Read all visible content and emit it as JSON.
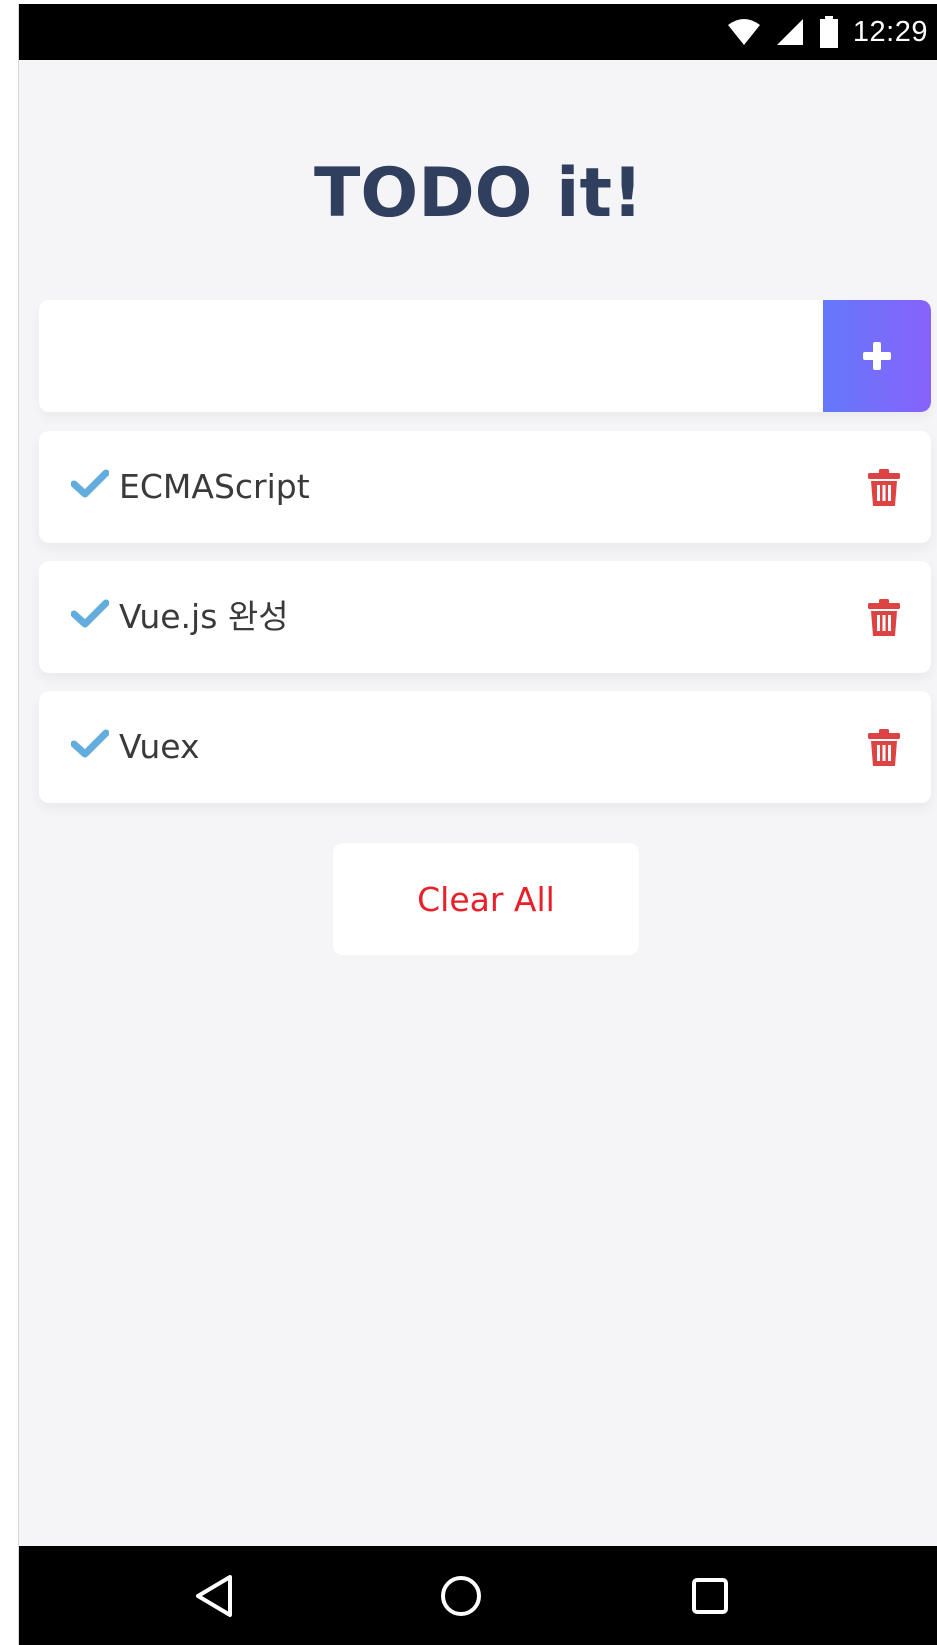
{
  "status_bar": {
    "time": "12:29",
    "icons": [
      "wifi-icon",
      "cell-signal-icon",
      "battery-icon"
    ]
  },
  "app": {
    "title": "TODO it!",
    "input": {
      "value": "",
      "placeholder": ""
    },
    "add_button_icon": "plus-icon",
    "todos": [
      {
        "text": "ECMAScript",
        "completed": true
      },
      {
        "text": "Vue.js 완성",
        "completed": true
      },
      {
        "text": "Vuex",
        "completed": true
      }
    ],
    "clear_label": "Clear All"
  },
  "nav_bar": {
    "buttons": [
      "back-icon",
      "home-icon",
      "recents-icon"
    ]
  },
  "colors": {
    "title": "#2f3f5d",
    "check": "#62acde",
    "trash": "#de4343",
    "clear_text": "#e8202a",
    "add_gradient_start": "#6478fb",
    "add_gradient_end": "#8763fb",
    "background": "#f5f5f7"
  }
}
